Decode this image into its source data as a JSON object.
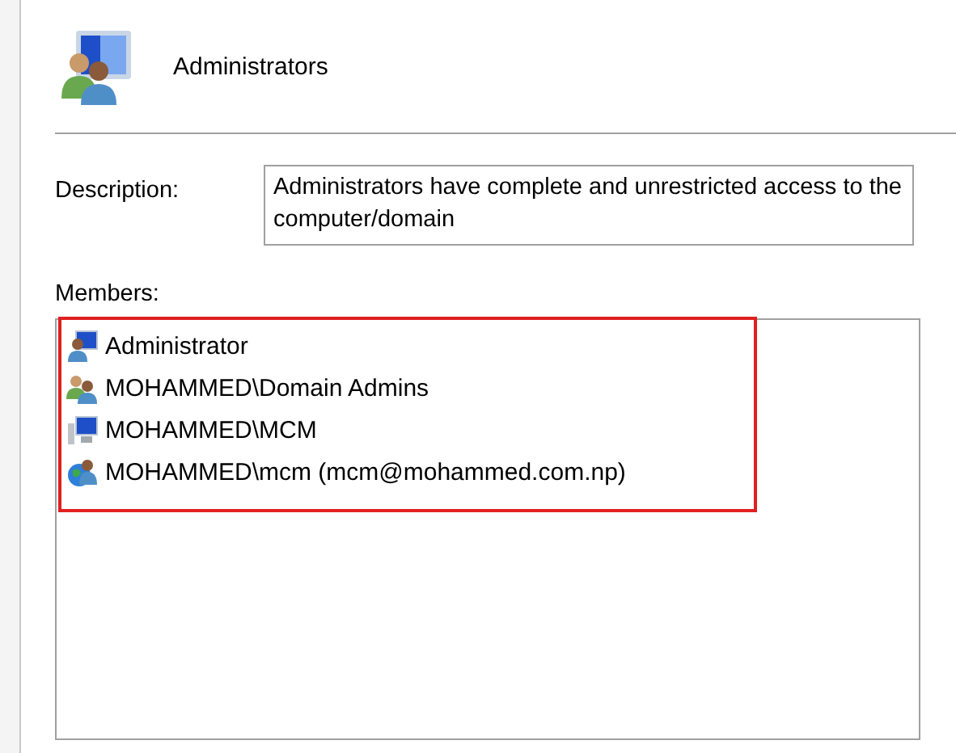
{
  "header": {
    "title": "Administrators"
  },
  "description": {
    "label": "Description:",
    "value": "Administrators have complete and unrestricted access to the computer/domain"
  },
  "members": {
    "label": "Members:",
    "highlighted": true,
    "items": [
      {
        "kind": "user",
        "name": "Administrator"
      },
      {
        "kind": "group",
        "name": "MOHAMMED\\Domain Admins"
      },
      {
        "kind": "computer",
        "name": "MOHAMMED\\MCM"
      },
      {
        "kind": "domain-user",
        "name": "MOHAMMED\\mcm (mcm@mohammed.com.np)"
      }
    ]
  }
}
